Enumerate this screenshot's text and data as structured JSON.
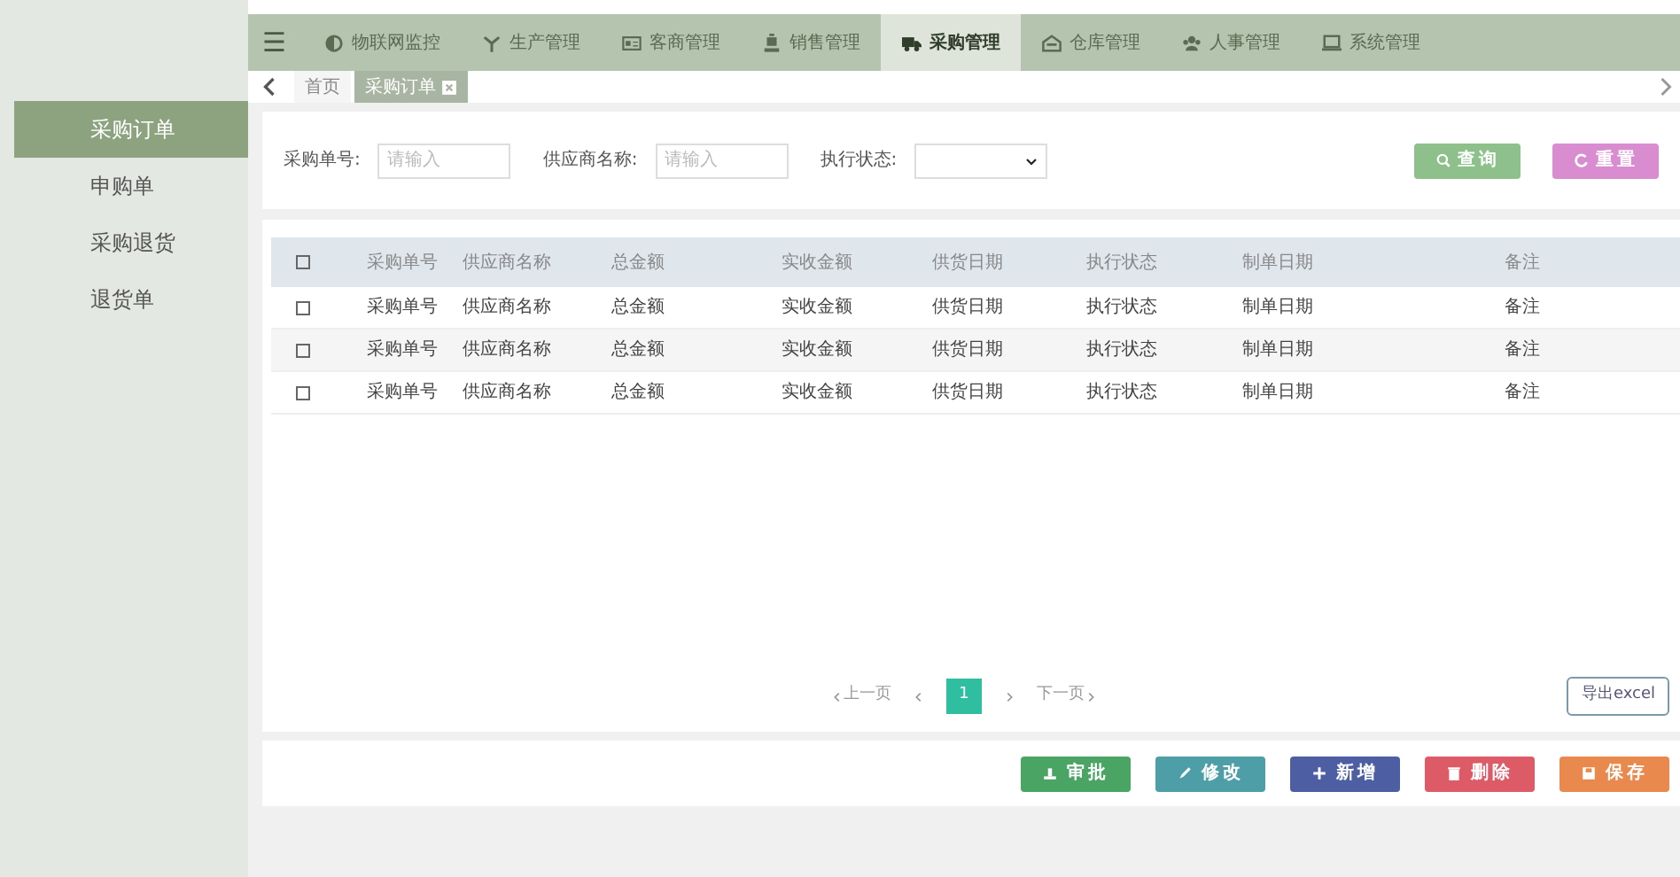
{
  "nav": {
    "menu_icon": "☰",
    "items": [
      {
        "label": "物联网监控",
        "selected": false
      },
      {
        "label": "生产管理",
        "selected": false
      },
      {
        "label": "客商管理",
        "selected": false
      },
      {
        "label": "销售管理",
        "selected": false
      },
      {
        "label": "采购管理",
        "selected": true
      },
      {
        "label": "仓库管理",
        "selected": false
      },
      {
        "label": "人事管理",
        "selected": false
      },
      {
        "label": "系统管理",
        "selected": false
      }
    ]
  },
  "page_tabs": [
    {
      "label": "首页",
      "closable": false,
      "selected": false
    },
    {
      "label": "采购订单",
      "closable": true,
      "selected": true
    }
  ],
  "sidebar": {
    "items": [
      {
        "label": "采购订单",
        "selected": true
      },
      {
        "label": "申购单",
        "selected": false
      },
      {
        "label": "采购退货",
        "selected": false
      },
      {
        "label": "退货单",
        "selected": false
      }
    ]
  },
  "filters": [
    {
      "label": "采购单号:",
      "kind": "text",
      "placeholder": "请输入"
    },
    {
      "label": "供应商名称:",
      "kind": "text",
      "placeholder": "请输入"
    },
    {
      "label": "执行状态:",
      "kind": "select"
    }
  ],
  "filter_buttons": [
    {
      "label": "查询",
      "kind": "search"
    },
    {
      "label": "重置",
      "kind": "reset"
    }
  ],
  "table": {
    "header_checked": false,
    "columns": [
      "采购单号",
      "供应商名称",
      "总金额",
      "实收金额",
      "供货日期",
      "执行状态",
      "制单日期",
      "备注"
    ],
    "rows": [
      {
        "checked": false,
        "cells": [
          "采购单号",
          "供应商名称",
          "总金额",
          "实收金额",
          "供货日期",
          "执行状态",
          "制单日期",
          "备注"
        ]
      },
      {
        "checked": false,
        "cells": [
          "采购单号",
          "供应商名称",
          "总金额",
          "实收金额",
          "供货日期",
          "执行状态",
          "制单日期",
          "备注"
        ]
      },
      {
        "checked": false,
        "cells": [
          "采购单号",
          "供应商名称",
          "总金额",
          "实收金额",
          "供货日期",
          "执行状态",
          "制单日期",
          "备注"
        ]
      }
    ]
  },
  "pagination": {
    "prev": "上一页",
    "next": "下一页",
    "pages": [
      {
        "label": "1",
        "selected": true
      }
    ]
  },
  "export_button": "导出excel",
  "actions": [
    {
      "label": "审批",
      "kind": "approve"
    },
    {
      "label": "修改",
      "kind": "edit"
    },
    {
      "label": "新增",
      "kind": "add"
    },
    {
      "label": "删除",
      "kind": "delete"
    },
    {
      "label": "保存",
      "kind": "save"
    }
  ]
}
